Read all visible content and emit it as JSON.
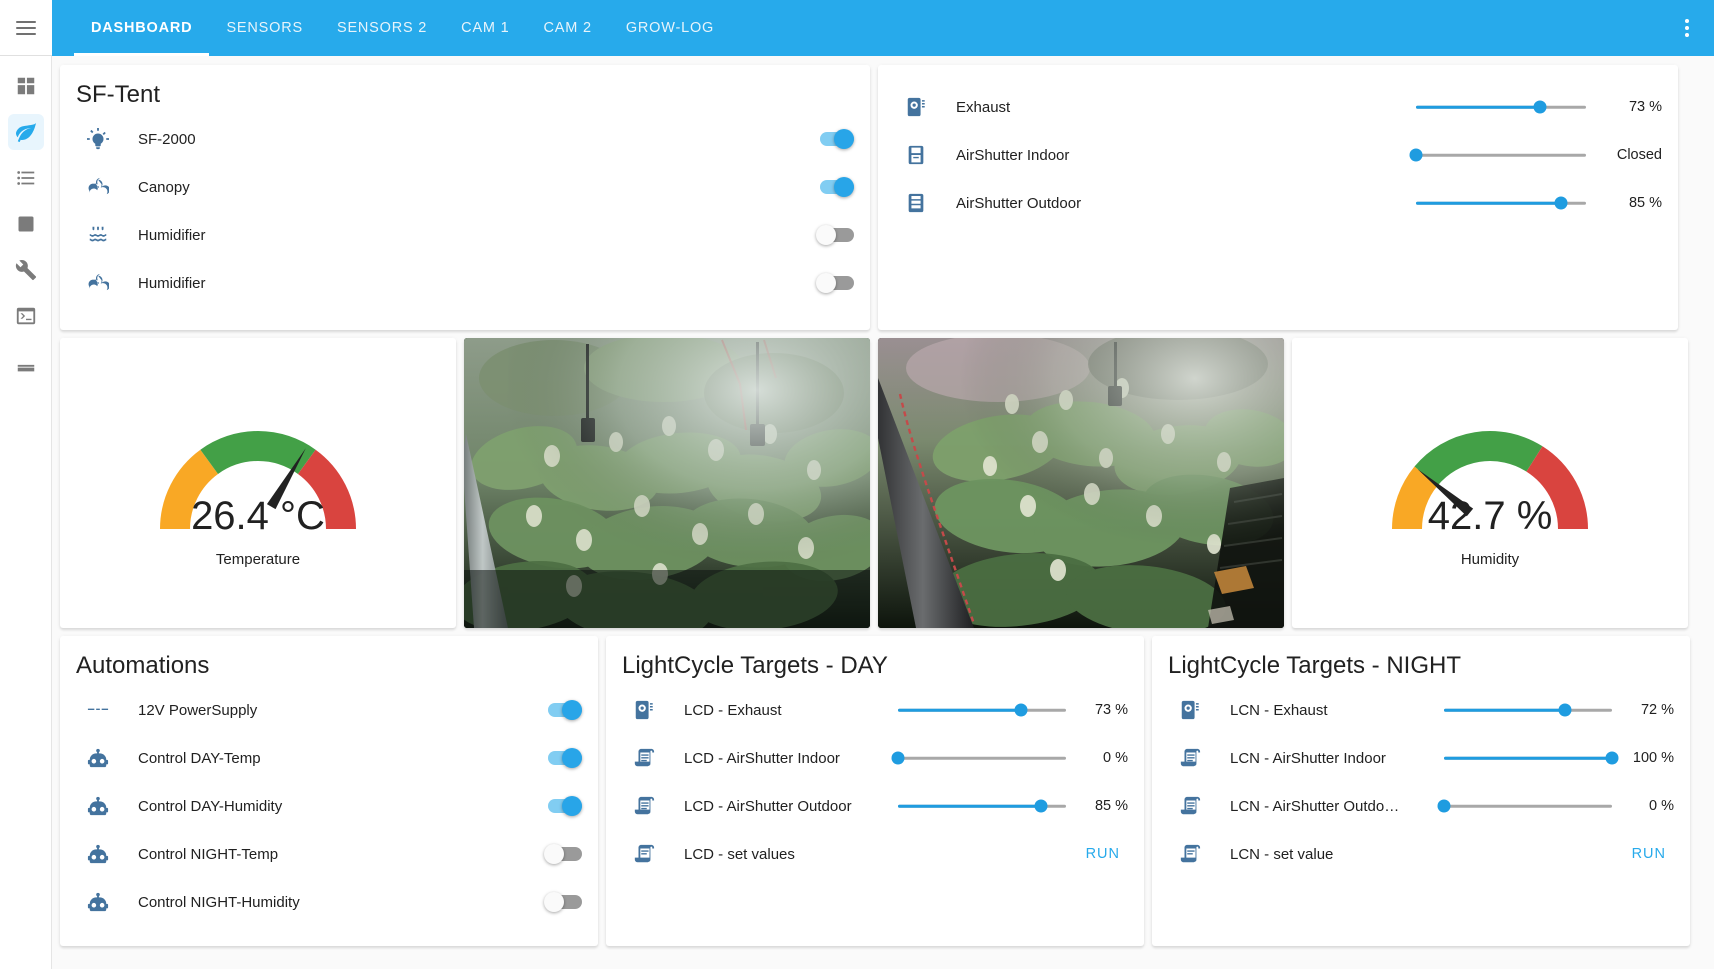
{
  "app": {
    "accent": "#27aaeb",
    "icon_color": "#44739e",
    "background": "#fafafa"
  },
  "topbar": {
    "menu_icon": "hamburger-menu-icon",
    "overflow_icon": "dots-vertical-icon",
    "tabs": [
      {
        "label": "DASHBOARD",
        "active": true
      },
      {
        "label": "SENSORS",
        "active": false
      },
      {
        "label": "SENSORS 2",
        "active": false
      },
      {
        "label": "CAM 1",
        "active": false
      },
      {
        "label": "CAM 2",
        "active": false
      },
      {
        "label": "GROW-LOG",
        "active": false
      }
    ]
  },
  "sidebar": {
    "items": [
      {
        "name": "overview",
        "icon": "view-dashboard-icon",
        "active": false
      },
      {
        "name": "grow",
        "icon": "leaf-icon",
        "active": true
      },
      {
        "name": "logbook",
        "icon": "format-list-bulleted-icon",
        "active": false
      },
      {
        "name": "history",
        "icon": "chart-box-icon",
        "active": false
      },
      {
        "name": "developer-tools",
        "icon": "wrench-icon",
        "active": false
      },
      {
        "name": "terminal",
        "icon": "console-icon",
        "active": false
      },
      {
        "name": "hacs",
        "icon": "hacs-icon",
        "active": false
      }
    ]
  },
  "tent_card": {
    "title": "SF-Tent",
    "rows": [
      {
        "icon": "lightbulb-on-icon",
        "name": "SF-2000",
        "state": "on"
      },
      {
        "icon": "fan-icon",
        "name": "Canopy",
        "state": "on"
      },
      {
        "icon": "air-humidifier-icon",
        "name": "Humidifier",
        "state": "off"
      },
      {
        "icon": "fan-icon",
        "name": "Humidifier",
        "state": "off"
      }
    ]
  },
  "fans_card": {
    "rows": [
      {
        "icon": "fan-speed-icon",
        "name": "Exhaust",
        "value": 73,
        "display": "73 %"
      },
      {
        "icon": "air-filter-icon",
        "name": "AirShutter Indoor",
        "value": 0,
        "display": "Closed"
      },
      {
        "icon": "air-shutter-icon",
        "name": "AirShutter Outdoor",
        "value": 85,
        "display": "85 %"
      }
    ]
  },
  "gauges": [
    {
      "name": "temperature-gauge",
      "value": 26.4,
      "display": "26.4 °C",
      "label": "Temperature",
      "needle_pct": 67,
      "segments": [
        {
          "color": "#f9a825",
          "from": 0,
          "to": 30
        },
        {
          "color": "#43a047",
          "from": 30,
          "to": 70
        },
        {
          "color": "#d9443f",
          "from": 70,
          "to": 100
        }
      ]
    },
    {
      "name": "humidity-gauge",
      "value": 42.7,
      "display": "42.7 %",
      "label": "Humidity",
      "needle_pct": 22,
      "segments": [
        {
          "color": "#f9a825",
          "from": 0,
          "to": 22
        },
        {
          "color": "#43a047",
          "from": 22,
          "to": 68
        },
        {
          "color": "#d9443f",
          "from": 68,
          "to": 100
        }
      ]
    }
  ],
  "cameras": [
    {
      "name": "cam-1",
      "alt": "Grow tent camera 1 - cannabis plants under mist"
    },
    {
      "name": "cam-2",
      "alt": "Grow tent camera 2 - cannabis plants under mist"
    }
  ],
  "automations_card": {
    "title": "Automations",
    "rows": [
      {
        "icon": "current-dc-icon",
        "name": "12V PowerSupply",
        "state": "on"
      },
      {
        "icon": "robot-icon",
        "name": "Control DAY-Temp",
        "state": "on"
      },
      {
        "icon": "robot-icon",
        "name": "Control DAY-Humidity",
        "state": "on"
      },
      {
        "icon": "robot-icon",
        "name": "Control NIGHT-Temp",
        "state": "off"
      },
      {
        "icon": "robot-icon",
        "name": "Control NIGHT-Humidity",
        "state": "off"
      }
    ]
  },
  "day_card": {
    "title": "LightCycle Targets - DAY",
    "rows": [
      {
        "icon": "fan-speed-icon",
        "name": "LCD - Exhaust",
        "value": 73,
        "display": "73 %",
        "type": "slider"
      },
      {
        "icon": "script-text-icon",
        "name": "LCD - AirShutter Indoor",
        "value": 0,
        "display": "0 %",
        "type": "slider"
      },
      {
        "icon": "script-text-icon",
        "name": "LCD - AirShutter Outdoor",
        "value": 85,
        "display": "85 %",
        "type": "slider"
      },
      {
        "icon": "script-icon",
        "name": "LCD - set values",
        "display": "RUN",
        "type": "action"
      }
    ]
  },
  "night_card": {
    "title": "LightCycle Targets - NIGHT",
    "rows": [
      {
        "icon": "fan-speed-icon",
        "name": "LCN - Exhaust",
        "value": 72,
        "display": "72 %",
        "type": "slider"
      },
      {
        "icon": "script-text-icon",
        "name": "LCN - AirShutter Indoor",
        "value": 100,
        "display": "100 %",
        "type": "slider"
      },
      {
        "icon": "script-text-icon",
        "name": "LCN - AirShutter Outdo…",
        "value": 0,
        "display": "0 %",
        "type": "slider"
      },
      {
        "icon": "script-icon",
        "name": "LCN - set value",
        "display": "RUN",
        "type": "action"
      }
    ]
  }
}
